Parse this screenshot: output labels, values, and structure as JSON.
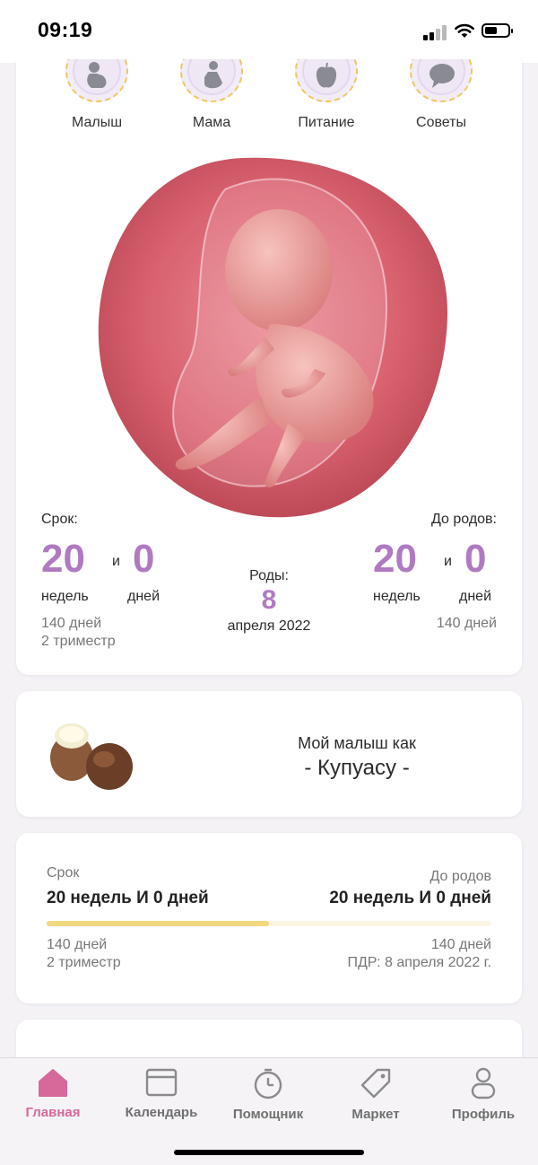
{
  "status_bar": {
    "time": "09:19"
  },
  "categories": [
    {
      "label": "Малыш",
      "icon": "baby-icon"
    },
    {
      "label": "Мама",
      "icon": "mother-icon"
    },
    {
      "label": "Питание",
      "icon": "apple-icon"
    },
    {
      "label": "Советы",
      "icon": "speech-bubble-icon"
    }
  ],
  "summary": {
    "term_label": "Срок:",
    "term_weeks": "20",
    "term_and": "и",
    "term_days": "0",
    "weeks_unit": "недель",
    "days_unit": "дней",
    "term_days_total": "140 дней",
    "trimester": "2 триместр",
    "birth_label": "Роды:",
    "birth_day": "8",
    "birth_month_year": "апреля 2022",
    "remaining_label": "До родов:",
    "remaining_weeks": "20",
    "remaining_and": "и",
    "remaining_days": "0",
    "remaining_days_total": "140 дней"
  },
  "baby_size": {
    "title": "Мой малыш как",
    "fruit": "- Купуасу -"
  },
  "progress": {
    "term_label": "Срок",
    "term_value": "20 недель И 0 дней",
    "remaining_label": "До родов",
    "remaining_value": "20 недель И 0 дней",
    "fraction": 0.5,
    "left_days": "140 дней",
    "left_trimester": "2 триместр",
    "right_days": "140 дней",
    "due_date": "ПДР: 8 апреля 2022 г."
  },
  "tabs": [
    {
      "label": "Главная",
      "icon": "home-icon",
      "active": true
    },
    {
      "label": "Календарь",
      "icon": "calendar-icon",
      "active": false
    },
    {
      "label": "Помощник",
      "icon": "stopwatch-icon",
      "active": false
    },
    {
      "label": "Маркет",
      "icon": "tag-icon",
      "active": false
    },
    {
      "label": "Профиль",
      "icon": "profile-icon",
      "active": false
    }
  ],
  "colors": {
    "accent": "#b07ac2",
    "active_tab": "#d6689a",
    "progress_fill": "#f2d77f"
  }
}
